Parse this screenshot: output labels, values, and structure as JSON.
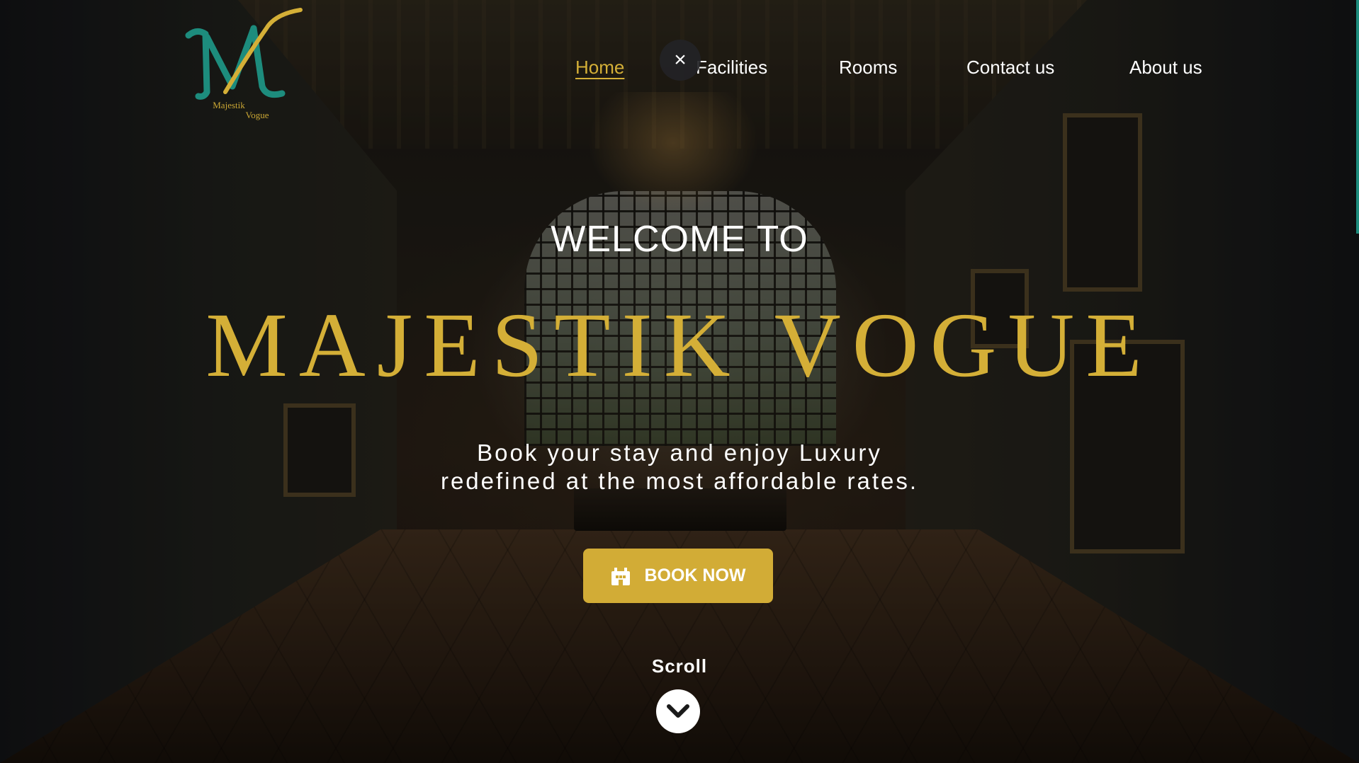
{
  "logo": {
    "line1": "Majestik",
    "line2": "Vogue",
    "monogram": "MV"
  },
  "nav": {
    "items": [
      {
        "label": "Home",
        "active": true
      },
      {
        "label": "Facilities",
        "active": false
      },
      {
        "label": "Rooms",
        "active": false
      },
      {
        "label": "Contact us",
        "active": false
      },
      {
        "label": "About us",
        "active": false
      }
    ],
    "close_icon": "×"
  },
  "hero": {
    "welcome": "WELCOME TO",
    "title": "MAJESTIK VOGUE",
    "tagline_line1": "Book your stay and enjoy Luxury",
    "tagline_line2": "redefined at the most affordable rates.",
    "book_button": "BOOK NOW",
    "book_icon": "hotel-icon",
    "scroll_label": "Scroll",
    "scroll_icon": "chevron-down-icon"
  },
  "colors": {
    "accent_gold": "#d4af37",
    "button_gold": "#d2ac36",
    "logo_teal": "#1d8c7d",
    "text": "#ffffff"
  }
}
